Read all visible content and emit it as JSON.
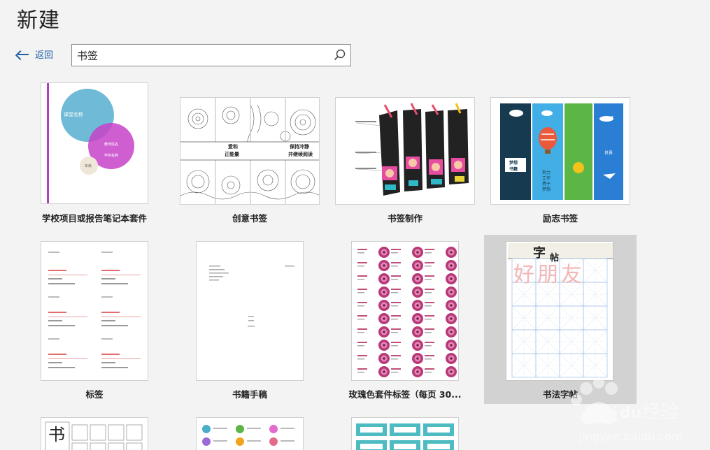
{
  "header": {
    "title": "新建"
  },
  "nav": {
    "back_label": "返回"
  },
  "search": {
    "value": "书签",
    "icon": "search-icon"
  },
  "templates": [
    {
      "label": "学校项目或报告笔记本套件",
      "preview_text": [
        "课堂名称",
        "教师姓名",
        "学校名称",
        "年级"
      ]
    },
    {
      "label": "创意书签",
      "preview_text": [
        "爱和",
        "正能量",
        "保持冷静",
        "并继续阅读"
      ]
    },
    {
      "label": "书签制作"
    },
    {
      "label": "励志书签",
      "preview_text": [
        "梦想",
        "书籍",
        "努力",
        "工作",
        "勇于",
        "梦想",
        "世界"
      ]
    },
    {
      "label": "标签"
    },
    {
      "label": "书籍手稿"
    },
    {
      "label": "玫瑰色套件标签（每页 30..."
    },
    {
      "label": "书法字帖",
      "preview_text": [
        "字",
        "帖",
        "好",
        "朋",
        "友"
      ]
    },
    {
      "label": "",
      "preview_text": [
        "书"
      ]
    },
    {
      "label": ""
    },
    {
      "label": ""
    }
  ],
  "watermark": {
    "brand": "Bai",
    "brand2": "du",
    "tail": "经验",
    "url": "jingyan.baidu.com"
  },
  "colors": {
    "accent": "#1e5fa8",
    "selected_bg": "#d2d2d2",
    "purple": "#b23cc2",
    "teal": "#4aaec8"
  }
}
